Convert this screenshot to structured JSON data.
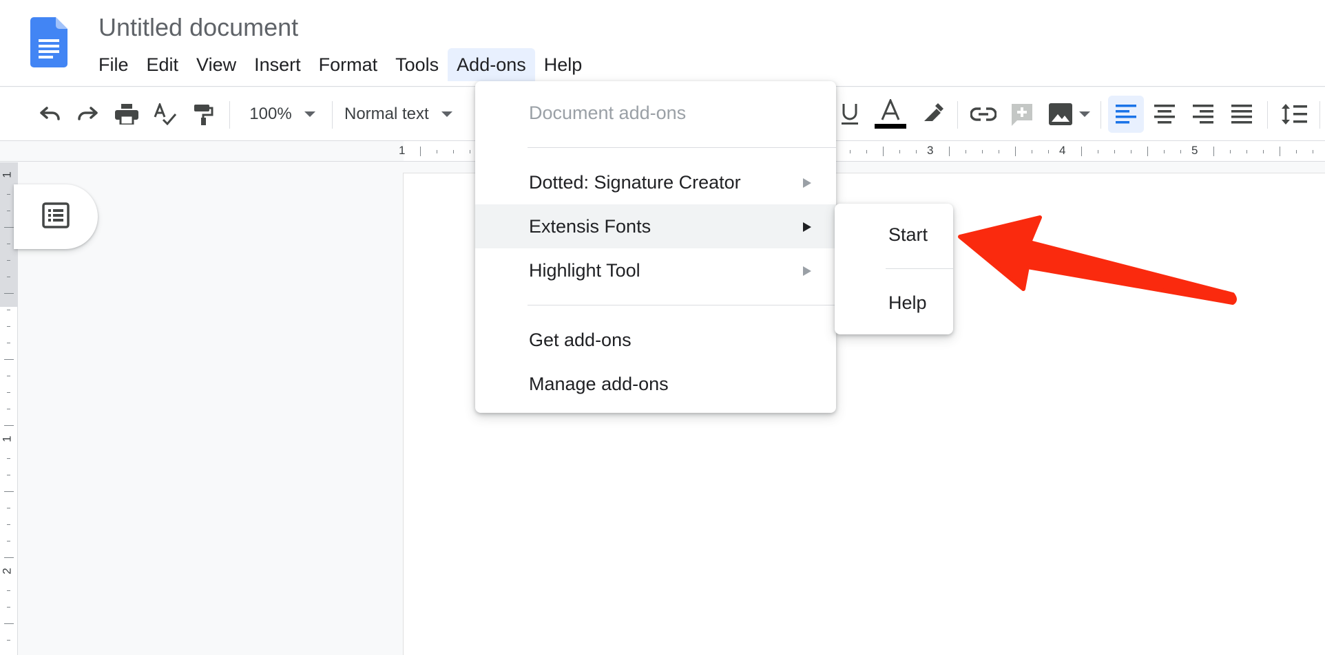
{
  "app": {
    "title": "Untitled document",
    "logo_icon": "google-docs-icon",
    "brand_color": "#4285f4"
  },
  "menubar": {
    "items": [
      "File",
      "Edit",
      "View",
      "Insert",
      "Format",
      "Tools",
      "Add-ons",
      "Help"
    ],
    "active": "Add-ons"
  },
  "toolbar": {
    "undo_icon": "undo-icon",
    "redo_icon": "redo-icon",
    "print_icon": "print-icon",
    "spellcheck_icon": "spellcheck-icon",
    "paint_format_icon": "paint-format-icon",
    "zoom": "100%",
    "style": "Normal text",
    "text_color_swatch": "#000000",
    "active_alignment": "left"
  },
  "ruler": {
    "horizontal_numbers": [
      "1",
      "3",
      "4",
      "5"
    ],
    "vertical_numbers": [
      "1",
      "1",
      "2"
    ]
  },
  "addons_menu": {
    "header": "Document add-ons",
    "addons": [
      {
        "label": "Dotted: Signature Creator",
        "has_submenu": true
      },
      {
        "label": "Extensis Fonts",
        "has_submenu": true,
        "highlighted": true
      },
      {
        "label": "Highlight Tool",
        "has_submenu": true
      }
    ],
    "actions": [
      "Get add-ons",
      "Manage add-ons"
    ]
  },
  "submenu": {
    "items": [
      "Start",
      "Help"
    ]
  },
  "annotation": {
    "arrow_color": "#fa2a0e"
  }
}
